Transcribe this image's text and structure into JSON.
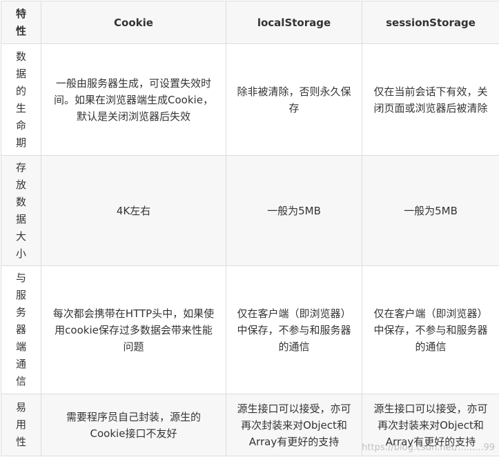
{
  "table": {
    "headers": [
      "特性",
      "Cookie",
      "localStorage",
      "sessionStorage"
    ],
    "rows": [
      {
        "feature": "数据的生命期",
        "cookie": "一般由服务器生成，可设置失效时间。如果在浏览器端生成Cookie，默认是关闭浏览器后失效",
        "localStorage": "除非被清除，否则永久保存",
        "sessionStorage": "仅在当前会话下有效，关闭页面或浏览器后被清除"
      },
      {
        "feature": "存放数据大小",
        "cookie": "4K左右",
        "localStorage": "一般为5MB",
        "sessionStorage": "一般为5MB"
      },
      {
        "feature": "与服务器端通信",
        "cookie": "每次都会携带在HTTP头中，如果使用cookie保存过多数据会带来性能问题",
        "localStorage": "仅在客户端（即浏览器）中保存，不参与和服务器的通信",
        "sessionStorage": "仅在客户端（即浏览器）中保存，不参与和服务器的通信"
      },
      {
        "feature": "易用性",
        "cookie": "需要程序员自己封装，源生的Cookie接口不友好",
        "localStorage": "源生接口可以接受，亦可再次封装来对Object和Array有更好的支持",
        "sessionStorage": "源生接口可以接受，亦可再次封装来对Object和Array有更好的支持"
      }
    ]
  },
  "watermark": "https://blog.csdn.net/.........99"
}
